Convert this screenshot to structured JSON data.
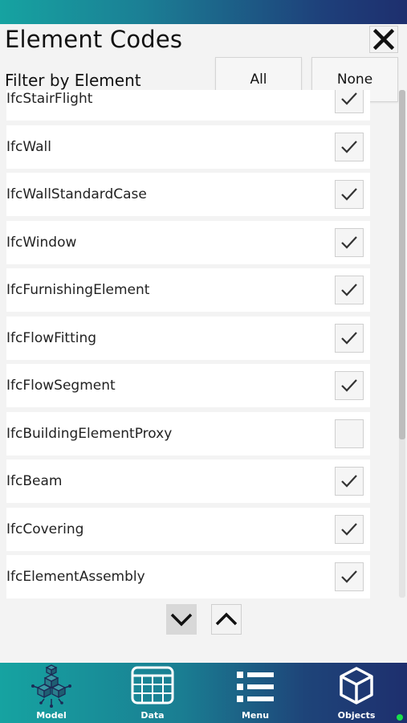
{
  "header": {
    "title": "Element Codes",
    "filter_label": "Filter by Element",
    "all_button": "All",
    "none_button": "None"
  },
  "elements": [
    {
      "label": "IfcStairFlight",
      "checked": true
    },
    {
      "label": "IfcWall",
      "checked": true
    },
    {
      "label": "IfcWallStandardCase",
      "checked": true
    },
    {
      "label": "IfcWindow",
      "checked": true
    },
    {
      "label": "IfcFurnishingElement",
      "checked": true
    },
    {
      "label": "IfcFlowFitting",
      "checked": true
    },
    {
      "label": "IfcFlowSegment",
      "checked": true
    },
    {
      "label": "IfcBuildingElementProxy",
      "checked": false
    },
    {
      "label": "IfcBeam",
      "checked": true
    },
    {
      "label": "IfcCovering",
      "checked": true
    },
    {
      "label": "IfcElementAssembly",
      "checked": true
    }
  ],
  "bottom_nav": {
    "items": [
      {
        "label": "Model",
        "icon": "model-cubes-icon"
      },
      {
        "label": "Data",
        "icon": "table-grid-icon"
      },
      {
        "label": "Menu",
        "icon": "list-menu-icon"
      },
      {
        "label": "Objects",
        "icon": "cube-icon"
      }
    ]
  },
  "colors": {
    "accent": "#2b6f86",
    "bar_start": "#16a3a1",
    "bar_end": "#1e2f6e",
    "status_dot": "#18e04a"
  }
}
